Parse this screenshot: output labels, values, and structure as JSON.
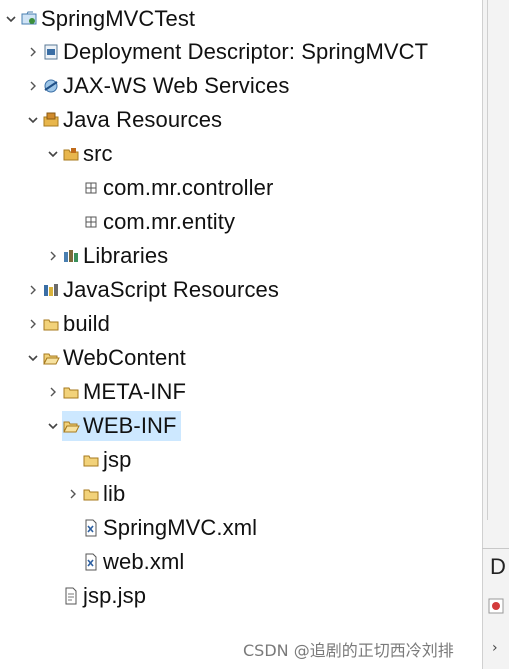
{
  "tree": {
    "nodes": [
      {
        "id": "springmvctest",
        "label": "SpringMVCTest",
        "chevron": "down",
        "icon": "project-icon"
      },
      {
        "id": "deployment-descriptor",
        "label": "Deployment Descriptor: SpringMVCT",
        "chevron": "right",
        "icon": "deployment-descriptor-icon"
      },
      {
        "id": "jax-ws",
        "label": "JAX-WS Web Services",
        "chevron": "right",
        "icon": "web-services-icon"
      },
      {
        "id": "java-resources",
        "label": "Java Resources",
        "chevron": "down",
        "icon": "java-resources-icon"
      },
      {
        "id": "src",
        "label": "src",
        "chevron": "down",
        "icon": "source-folder-icon"
      },
      {
        "id": "com-mr-controller",
        "label": "com.mr.controller",
        "chevron": "none",
        "icon": "package-icon"
      },
      {
        "id": "com-mr-entity",
        "label": "com.mr.entity",
        "chevron": "none",
        "icon": "package-icon"
      },
      {
        "id": "libraries",
        "label": "Libraries",
        "chevron": "right",
        "icon": "libraries-icon"
      },
      {
        "id": "javascript-resources",
        "label": "JavaScript Resources",
        "chevron": "right",
        "icon": "javascript-resources-icon"
      },
      {
        "id": "build",
        "label": "build",
        "chevron": "right",
        "icon": "folder-icon"
      },
      {
        "id": "webcontent",
        "label": "WebContent",
        "chevron": "down",
        "icon": "folder-open-icon"
      },
      {
        "id": "meta-inf",
        "label": "META-INF",
        "chevron": "right",
        "icon": "folder-icon"
      },
      {
        "id": "web-inf",
        "label": "WEB-INF",
        "chevron": "down",
        "icon": "folder-open-icon",
        "selected": true
      },
      {
        "id": "jsp",
        "label": "jsp",
        "chevron": "none",
        "icon": "folder-icon"
      },
      {
        "id": "lib",
        "label": "lib",
        "chevron": "right",
        "icon": "folder-icon"
      },
      {
        "id": "springmvc-xml",
        "label": "SpringMVC.xml",
        "chevron": "none",
        "icon": "xml-file-icon"
      },
      {
        "id": "web-xml",
        "label": "web.xml",
        "chevron": "none",
        "icon": "xml-file-icon"
      },
      {
        "id": "jsp-jsp",
        "label": "jsp.jsp",
        "chevron": "none",
        "icon": "jsp-file-icon"
      }
    ]
  },
  "side_panel": {
    "letter": "D"
  },
  "watermark": "CSDN @追剧的正切西冷刘排",
  "colors": {
    "selection": "#cde8ff",
    "folder": "#e8b64c",
    "folder_outline": "#a77a1e"
  }
}
